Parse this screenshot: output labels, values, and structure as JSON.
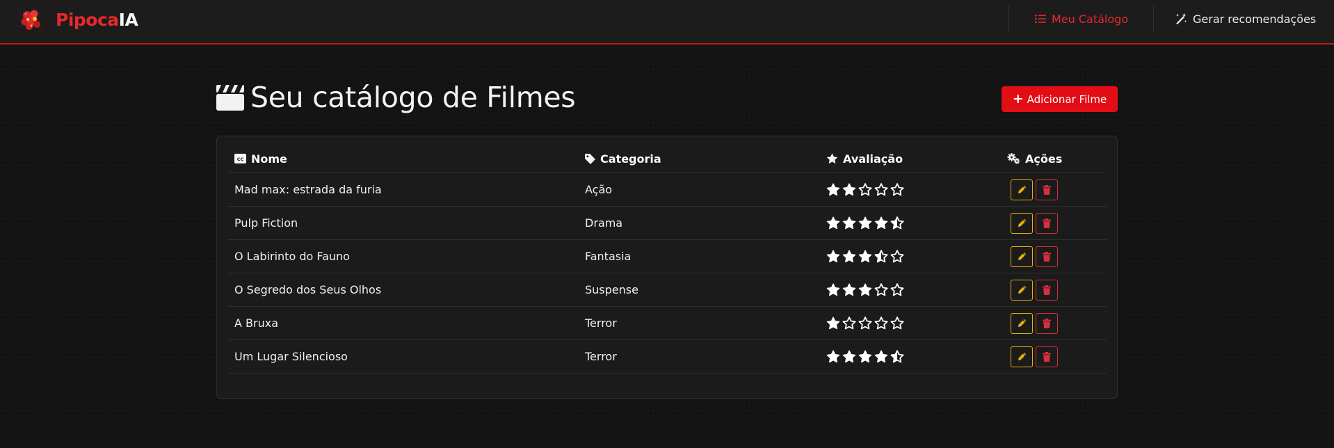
{
  "brand": {
    "name_part1": "Pipoca",
    "name_part2": "IA"
  },
  "nav": {
    "catalog": "Meu Catálogo",
    "recommend": "Gerar recomendações"
  },
  "page": {
    "title": "Seu catálogo de Filmes",
    "add_button": "Adicionar Filme"
  },
  "table": {
    "headers": {
      "name": "Nome",
      "category": "Categoria",
      "rating": "Avaliação",
      "actions": "Ações"
    },
    "rows": [
      {
        "name": "Mad max: estrada da furia",
        "category": "Ação",
        "rating": 2
      },
      {
        "name": "Pulp Fiction",
        "category": "Drama",
        "rating": 4.5
      },
      {
        "name": "O Labirinto do Fauno",
        "category": "Fantasia",
        "rating": 3.5
      },
      {
        "name": "O Segredo dos Seus Olhos",
        "category": "Suspense",
        "rating": 3
      },
      {
        "name": "A Bruxa",
        "category": "Terror",
        "rating": 1
      },
      {
        "name": "Um Lugar Silencioso",
        "category": "Terror",
        "rating": 4.5
      }
    ]
  },
  "colors": {
    "accent": "#e30d16",
    "edit": "#e8b007",
    "delete": "#d6303c"
  },
  "icons": {
    "logo": "popcorn-logo-icon",
    "catalog": "list-icon",
    "recommend": "magic-wand-icon",
    "title": "clapperboard-icon",
    "add": "plus-icon",
    "name": "closed-captioning-icon",
    "category": "tag-icon",
    "rating": "star-icon",
    "actions": "gears-icon",
    "edit": "pencil-icon",
    "delete": "trash-icon"
  }
}
